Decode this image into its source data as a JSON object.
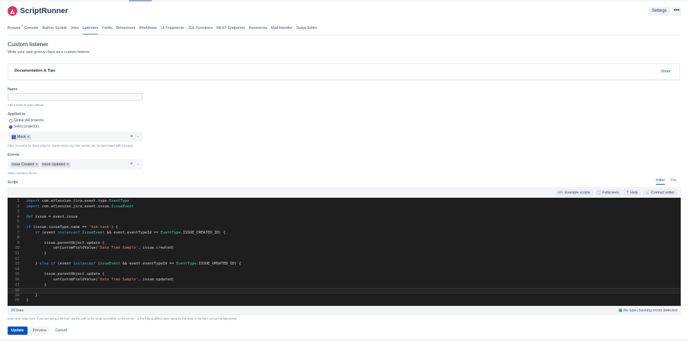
{
  "app": {
    "name": "ScriptRunner",
    "settings": "Settings",
    "more": "•••"
  },
  "nav": [
    "Browse",
    "Console",
    "Built-in Scripts",
    "Jobs",
    "Listeners",
    "Fields",
    "Behaviours",
    "Workflows",
    "UI Fragments",
    "JQL Functions",
    "REST Endpoints",
    "Resources",
    "Mail Handler",
    "Script Editor"
  ],
  "nav_active": 4,
  "page": {
    "title": "Custom listener",
    "subtitle": "Write your own groovy class as a custom listener."
  },
  "doc": {
    "title": "Documentation & Tips",
    "show": "Show"
  },
  "name_field": {
    "label": "Name",
    "value": "",
    "hint": "Add a name to your Listener"
  },
  "applied": {
    "label": "Applied to",
    "options": [
      "Global (All projects)",
      "Select project(s)"
    ],
    "selected": 1,
    "projects": [
      "Mock"
    ],
    "hint": "Filter on events for these projects. Some events, eg User events, are not associated with a project."
  },
  "events": {
    "label": "Events",
    "tags": [
      "Issue Created",
      "Issue Updated"
    ],
    "hint": "Which events to fire on."
  },
  "script": {
    "label": "Script",
    "tabs": [
      "Inline",
      "File"
    ],
    "toolbar": [
      "Example scripts",
      "Fullscreen",
      "Help",
      "Contract editor"
    ],
    "toolbar_icons": [
      "</>",
      "⛶",
      "?",
      "↔"
    ],
    "lines": [
      "import com.atlassian.jira.event.type.EventType",
      "import com.atlassian.jira.event.issue.IssueEvent",
      "",
      "def issue = event.issue",
      "",
      "if (issue.issueType.name == 'Sub-task') {",
      "    if (event instanceof IssueEvent && event.eventTypeId == EventType.ISSUE_CREATED_ID) {",
      "",
      "        issue.parentObject.update {",
      "            setCustomFieldValue('Date Time Sample', issue.created)",
      "        }",
      "",
      "    } else if (event instanceof IssueEvent && event.eventTypeId == EventType.ISSUE_UPDATED_ID) {",
      "",
      "        issue.parentObject.update {",
      "            setCustomFieldValue('Date Time Sample', issue.updated)",
      "        }",
      "",
      "    }",
      "}"
    ],
    "current_line": 18,
    "line_count": "20 lines",
    "status": "No type checking errors detected",
    "hint": "Enter your script here. If you are using a file then use the path to the script accessible on the server - or the fully-qualified class name for the class in the form com.acme.MyListener"
  },
  "actions": {
    "update": "Update",
    "preview": "Preview",
    "cancel": "Cancel"
  }
}
